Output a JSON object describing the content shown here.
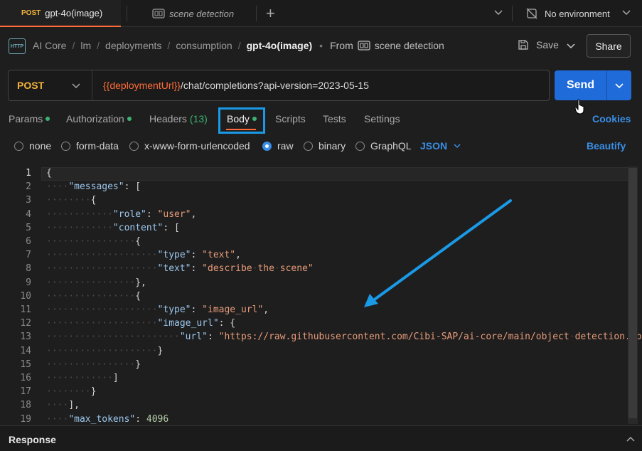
{
  "tabs": {
    "active": {
      "method": "POST",
      "label": "gpt-4o(image)"
    },
    "second": {
      "label": "scene detection"
    }
  },
  "environment": {
    "label": "No environment"
  },
  "breadcrumb": {
    "items": [
      "AI Core",
      "lm",
      "deployments",
      "consumption"
    ],
    "current": "gpt-4o(image)",
    "from_label": "From",
    "from_name": "scene detection"
  },
  "toolbar": {
    "save_label": "Save",
    "share_label": "Share"
  },
  "request": {
    "method": "POST",
    "url_var": "{{deploymentUrl}}",
    "url_rest": "/chat/completions?api-version=2023-05-15",
    "send_label": "Send"
  },
  "request_tabs": {
    "params": "Params",
    "authorization": "Authorization",
    "headers": "Headers",
    "headers_count": "(13)",
    "body": "Body",
    "scripts": "Scripts",
    "tests": "Tests",
    "settings": "Settings",
    "cookies": "Cookies"
  },
  "body_types": {
    "options": [
      "none",
      "form-data",
      "x-www-form-urlencoded",
      "raw",
      "binary",
      "GraphQL"
    ],
    "selected": "raw",
    "format": "JSON",
    "beautify": "Beautify"
  },
  "editor": {
    "line_numbers": [
      "1",
      "2",
      "3",
      "4",
      "5",
      "6",
      "7",
      "8",
      "9",
      "10",
      "11",
      "12",
      "13",
      "14",
      "15",
      "16",
      "17",
      "18",
      "19"
    ],
    "lines": [
      "{",
      "    \"messages\": [",
      "        {",
      "            \"role\": \"user\",",
      "            \"content\": [",
      "                {",
      "                    \"type\": \"text\",",
      "                    \"text\": \"describe the scene\"",
      "                },",
      "                {",
      "                    \"type\": \"image_url\",",
      "                    \"image_url\": {",
      "                        \"url\": \"https://raw.githubusercontent.com/Cibi-SAP/ai-core/main/object detection.jpg\"",
      "                    }",
      "                }",
      "            ]",
      "        }",
      "    ],",
      "    \"max_tokens\": 4096"
    ]
  },
  "response": {
    "label": "Response"
  },
  "colors": {
    "accent": "#ff6c37",
    "send": "#1f6bd9",
    "link": "#3a8ee6",
    "highlight_box": "#1a9ae6",
    "annotation_arrow": "#1a9ae6"
  }
}
